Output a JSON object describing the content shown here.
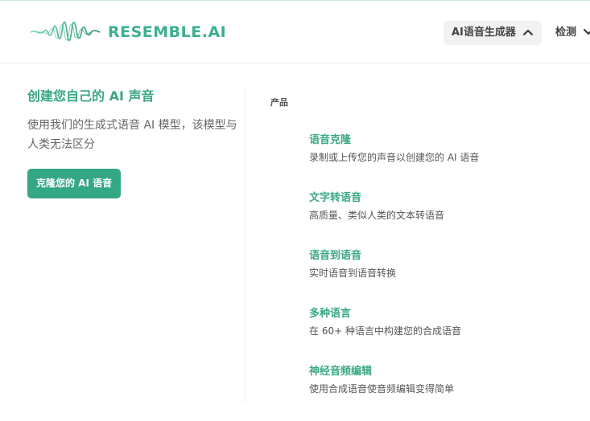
{
  "header": {
    "logo_text": "RESEMBLE.AI",
    "nav": [
      {
        "label": "AI语音生成器",
        "expanded": true
      },
      {
        "label": "检测",
        "expanded": false
      }
    ]
  },
  "hero": {
    "title": "创建您自己的 AI 声音",
    "description": "使用我们的生成式语音 AI 模型，该模型与人类无法区分",
    "cta_label": "克隆您的 AI 语音"
  },
  "products": {
    "section_title": "产品",
    "items": [
      {
        "title": "语音克隆",
        "description": "录制或上传您的声音以创建您的 AI 语音"
      },
      {
        "title": "文字转语音",
        "description": "高质量、类似人类的文本转语音"
      },
      {
        "title": "语音到语音",
        "description": "实时语音到语音转换"
      },
      {
        "title": "多种语言",
        "description": "在 60+ 种语言中构建您的合成语音"
      },
      {
        "title": "神经音频编辑",
        "description": "使用合成语音使音频编辑变得简单"
      }
    ]
  },
  "colors": {
    "brand": "#3bb08f",
    "cta": "#34a785",
    "accent_text": "#3aa883"
  },
  "icons": {
    "logo": "waveform-icon",
    "chevron_up": "chevron-up-icon",
    "chevron_down": "chevron-down-icon"
  }
}
